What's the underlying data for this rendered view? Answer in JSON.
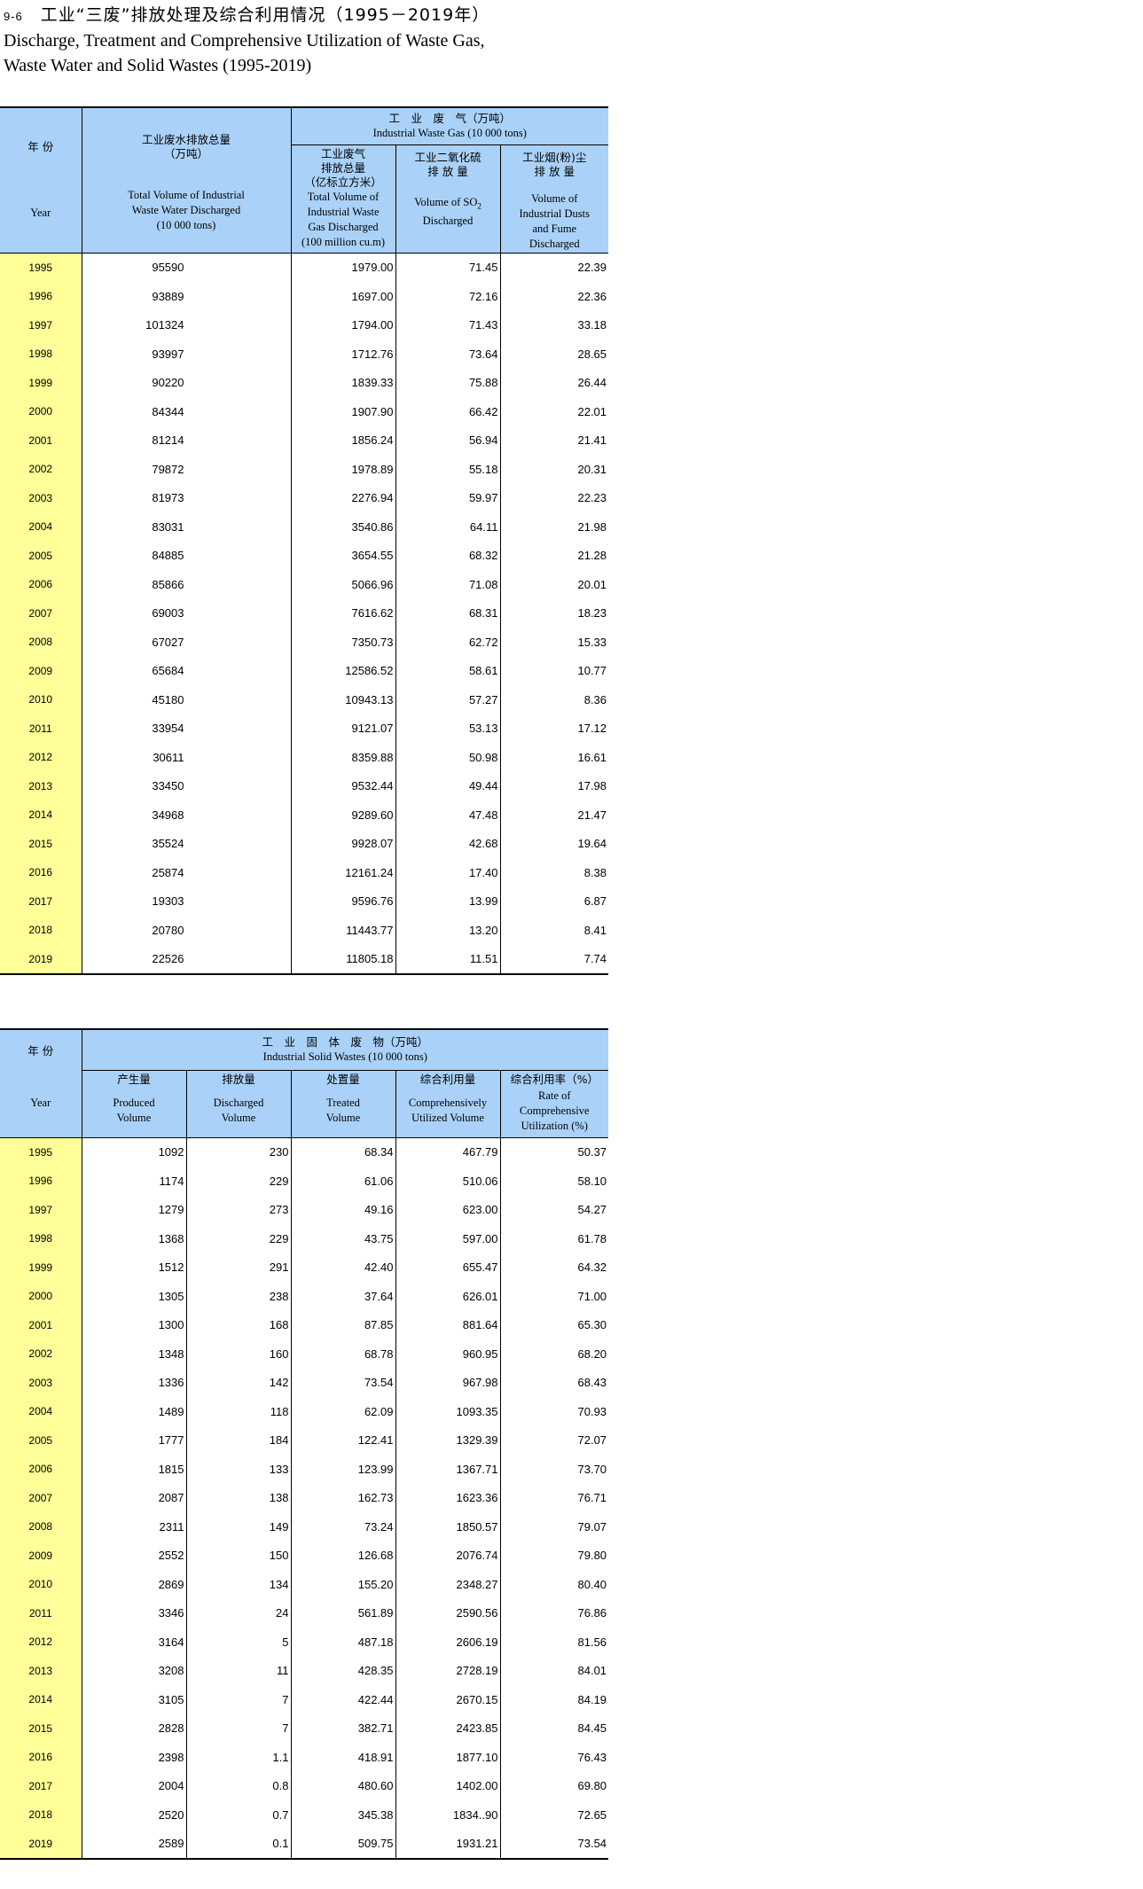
{
  "title": {
    "number": "9-6",
    "cn": "工业“三废”排放处理及综合利用情况（1995－2019年）",
    "en_line1": "Discharge, Treatment and Comprehensive Utilization of Waste Gas,",
    "en_line2": "Waste Water and Solid Wastes (1995-2019)"
  },
  "table1": {
    "year_cn": "年 份",
    "year_en": "Year",
    "water_cn": "工业废水排放总量",
    "water_cn_unit": "（万吨）",
    "water_en1": "Total Volume of Industrial",
    "water_en2": "Waste Water Discharged",
    "water_en3": "(10 000 tons)",
    "gas_group_cn": "工　业　废　气（万吨）",
    "gas_group_en": "Industrial Waste Gas (10 000 tons)",
    "gas_total_cn1": "工业废气",
    "gas_total_cn2": "排放总量",
    "gas_total_cn3": "（亿标立方米）",
    "gas_total_en1": "Total Volume of",
    "gas_total_en2": "Industrial Waste",
    "gas_total_en3": "Gas Discharged",
    "gas_total_en4": "(100 million cu.m)",
    "so2_cn1": "工业二氧化硫",
    "so2_cn2": "排 放 量",
    "so2_en1": "Volume of SO",
    "so2_en_sub": "2",
    "so2_en2": "Discharged",
    "dust_cn1": "工业烟(粉)尘",
    "dust_cn2": "排 放 量",
    "dust_en1": "Volume of",
    "dust_en2": "Industrial Dusts",
    "dust_en3": "and Fume",
    "dust_en4": "Discharged",
    "rows": [
      [
        "1995",
        "95590",
        "1979.00",
        "71.45",
        "22.39"
      ],
      [
        "1996",
        "93889",
        "1697.00",
        "72.16",
        "22.36"
      ],
      [
        "1997",
        "101324",
        "1794.00",
        "71.43",
        "33.18"
      ],
      [
        "1998",
        "93997",
        "1712.76",
        "73.64",
        "28.65"
      ],
      [
        "1999",
        "90220",
        "1839.33",
        "75.88",
        "26.44"
      ],
      [
        "2000",
        "84344",
        "1907.90",
        "66.42",
        "22.01"
      ],
      [
        "2001",
        "81214",
        "1856.24",
        "56.94",
        "21.41"
      ],
      [
        "2002",
        "79872",
        "1978.89",
        "55.18",
        "20.31"
      ],
      [
        "2003",
        "81973",
        "2276.94",
        "59.97",
        "22.23"
      ],
      [
        "2004",
        "83031",
        "3540.86",
        "64.11",
        "21.98"
      ],
      [
        "2005",
        "84885",
        "3654.55",
        "68.32",
        "21.28"
      ],
      [
        "2006",
        "85866",
        "5066.96",
        "71.08",
        "20.01"
      ],
      [
        "2007",
        "69003",
        "7616.62",
        "68.31",
        "18.23"
      ],
      [
        "2008",
        "67027",
        "7350.73",
        "62.72",
        "15.33"
      ],
      [
        "2009",
        "65684",
        "12586.52",
        "58.61",
        "10.77"
      ],
      [
        "2010",
        "45180",
        "10943.13",
        "57.27",
        "8.36"
      ],
      [
        "2011",
        "33954",
        "9121.07",
        "53.13",
        "17.12"
      ],
      [
        "2012",
        "30611",
        "8359.88",
        "50.98",
        "16.61"
      ],
      [
        "2013",
        "33450",
        "9532.44",
        "49.44",
        "17.98"
      ],
      [
        "2014",
        "34968",
        "9289.60",
        "47.48",
        "21.47"
      ],
      [
        "2015",
        "35524",
        "9928.07",
        "42.68",
        "19.64"
      ],
      [
        "2016",
        "25874",
        "12161.24",
        "17.40",
        "8.38"
      ],
      [
        "2017",
        "19303",
        "9596.76",
        "13.99",
        "6.87"
      ],
      [
        "2018",
        "20780",
        "11443.77",
        "13.20",
        "8.41"
      ],
      [
        "2019",
        "22526",
        "11805.18",
        "11.51",
        "7.74"
      ]
    ]
  },
  "table2": {
    "year_cn": "年 份",
    "year_en": "Year",
    "group_cn": "工　业　固　体　废　物（万吨）",
    "group_en": "Industrial Solid Wastes (10 000 tons)",
    "produced_cn": "产生量",
    "produced_en1": "Produced",
    "produced_en2": "Volume",
    "discharged_cn": "排放量",
    "discharged_en1": "Discharged",
    "discharged_en2": "Volume",
    "treated_cn": "处置量",
    "treated_en1": "Treated",
    "treated_en2": "Volume",
    "utilized_cn": "综合利用量",
    "utilized_en1": "Comprehensively",
    "utilized_en2": "Utilized Volume",
    "rate_cn": "综合利用率（%）",
    "rate_en1": "Rate of",
    "rate_en2": "Comprehensive",
    "rate_en3": "Utilization (%)",
    "rows": [
      [
        "1995",
        "1092",
        "230",
        "68.34",
        "467.79",
        "50.37"
      ],
      [
        "1996",
        "1174",
        "229",
        "61.06",
        "510.06",
        "58.10"
      ],
      [
        "1997",
        "1279",
        "273",
        "49.16",
        "623.00",
        "54.27"
      ],
      [
        "1998",
        "1368",
        "229",
        "43.75",
        "597.00",
        "61.78"
      ],
      [
        "1999",
        "1512",
        "291",
        "42.40",
        "655.47",
        "64.32"
      ],
      [
        "2000",
        "1305",
        "238",
        "37.64",
        "626.01",
        "71.00"
      ],
      [
        "2001",
        "1300",
        "168",
        "87.85",
        "881.64",
        "65.30"
      ],
      [
        "2002",
        "1348",
        "160",
        "68.78",
        "960.95",
        "68.20"
      ],
      [
        "2003",
        "1336",
        "142",
        "73.54",
        "967.98",
        "68.43"
      ],
      [
        "2004",
        "1489",
        "118",
        "62.09",
        "1093.35",
        "70.93"
      ],
      [
        "2005",
        "1777",
        "184",
        "122.41",
        "1329.39",
        "72.07"
      ],
      [
        "2006",
        "1815",
        "133",
        "123.99",
        "1367.71",
        "73.70"
      ],
      [
        "2007",
        "2087",
        "138",
        "162.73",
        "1623.36",
        "76.71"
      ],
      [
        "2008",
        "2311",
        "149",
        "73.24",
        "1850.57",
        "79.07"
      ],
      [
        "2009",
        "2552",
        "150",
        "126.68",
        "2076.74",
        "79.80"
      ],
      [
        "2010",
        "2869",
        "134",
        "155.20",
        "2348.27",
        "80.40"
      ],
      [
        "2011",
        "3346",
        "24",
        "561.89",
        "2590.56",
        "76.86"
      ],
      [
        "2012",
        "3164",
        "5",
        "487.18",
        "2606.19",
        "81.56"
      ],
      [
        "2013",
        "3208",
        "11",
        "428.35",
        "2728.19",
        "84.01"
      ],
      [
        "2014",
        "3105",
        "7",
        "422.44",
        "2670.15",
        "84.19"
      ],
      [
        "2015",
        "2828",
        "7",
        "382.71",
        "2423.85",
        "84.45"
      ],
      [
        "2016",
        "2398",
        "1.1",
        "418.91",
        "1877.10",
        "76.43"
      ],
      [
        "2017",
        "2004",
        "0.8",
        "480.60",
        "1402.00",
        "69.80"
      ],
      [
        "2018",
        "2520",
        "0.7",
        "345.38",
        "1834..90",
        "72.65"
      ],
      [
        "2019",
        "2589",
        "0.1",
        "509.75",
        "1931.21",
        "73.54"
      ]
    ]
  }
}
